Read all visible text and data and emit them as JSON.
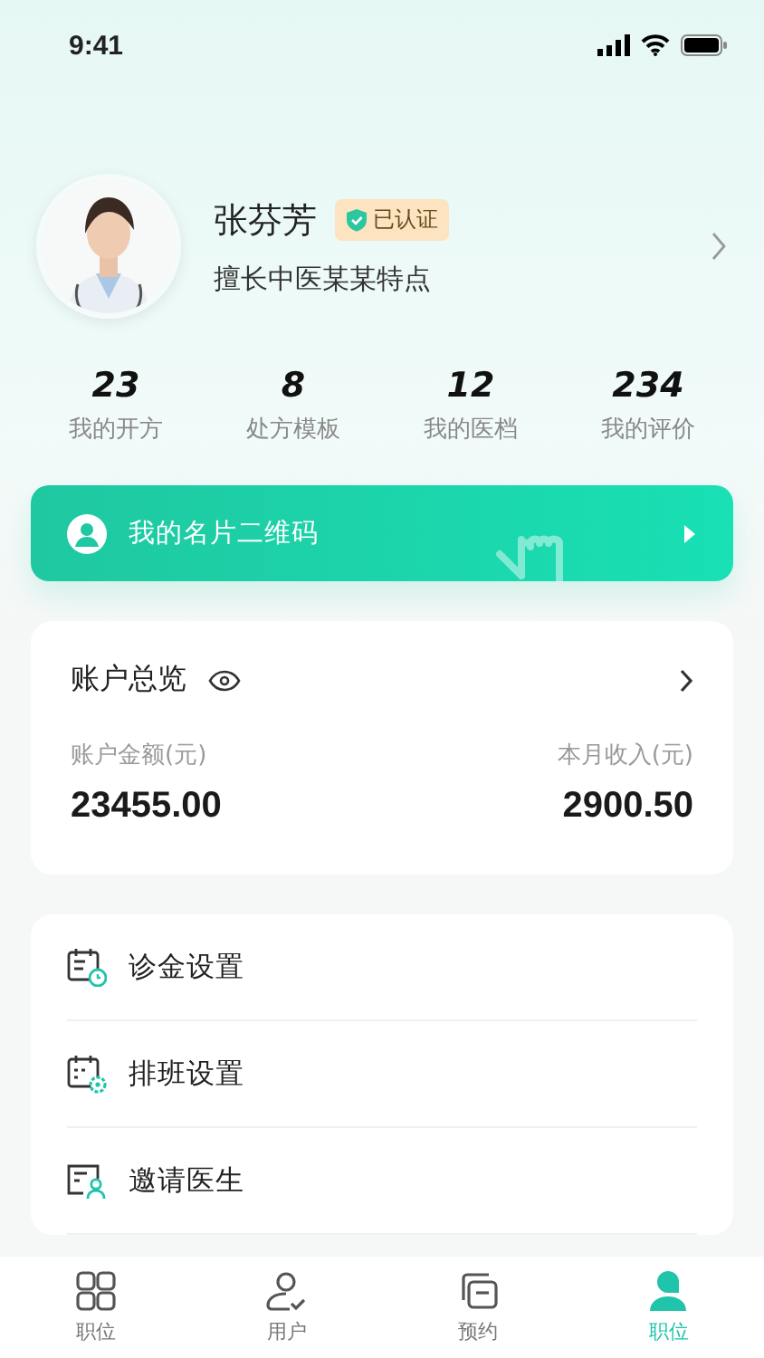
{
  "status_bar": {
    "time": "9:41"
  },
  "profile": {
    "name": "张芬芳",
    "badge": "已认证",
    "specialty": "擅长中医某某特点"
  },
  "stats": [
    {
      "value": "23",
      "label": "我的开方"
    },
    {
      "value": "8",
      "label": "处方模板"
    },
    {
      "value": "12",
      "label": "我的医档"
    },
    {
      "value": "234",
      "label": "我的评价"
    }
  ],
  "qr_banner": {
    "label": "我的名片二维码"
  },
  "account": {
    "title": "账户总览",
    "balance_label": "账户金额(元)",
    "balance": "23455.00",
    "income_label": "本月收入(元)",
    "income": "2900.50"
  },
  "menu": [
    {
      "kind": "fee",
      "label": "诊金设置"
    },
    {
      "kind": "schedule",
      "label": "排班设置"
    },
    {
      "kind": "invite",
      "label": "邀请医生"
    }
  ],
  "tab_bar": [
    {
      "kind": "grid",
      "label": "职位",
      "selected": false
    },
    {
      "kind": "user",
      "label": "用户",
      "selected": false
    },
    {
      "kind": "chat",
      "label": "预约",
      "selected": false
    },
    {
      "kind": "person",
      "label": "职位",
      "selected": true
    }
  ]
}
